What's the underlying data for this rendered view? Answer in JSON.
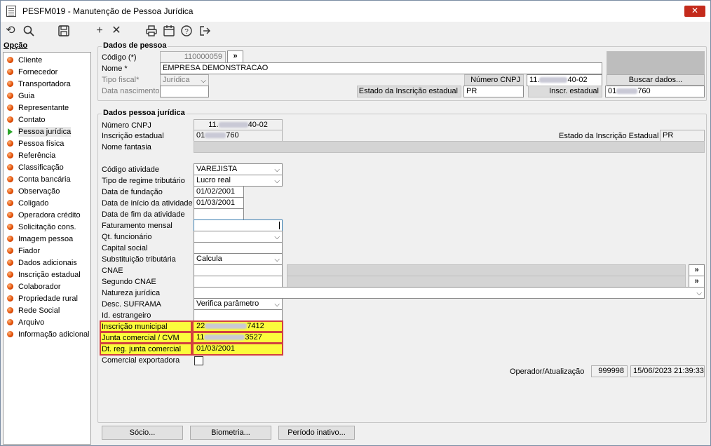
{
  "window": {
    "title": "PESFM019 - Manutenção de Pessoa Jurídica",
    "close_glyph": "✕"
  },
  "toolbar": {
    "icons": [
      "undo-icon",
      "search-icon",
      "save-icon",
      "add-icon",
      "delete-icon",
      "print-icon",
      "calendar-icon",
      "help-icon",
      "exit-icon"
    ]
  },
  "sidebar": {
    "header": "Opção",
    "items": [
      {
        "label": "Cliente"
      },
      {
        "label": "Fornecedor"
      },
      {
        "label": "Transportadora"
      },
      {
        "label": "Guia"
      },
      {
        "label": "Representante"
      },
      {
        "label": "Contato"
      },
      {
        "label": "Pessoa jurídica",
        "active": true
      },
      {
        "label": "Pessoa física"
      },
      {
        "label": "Referência"
      },
      {
        "label": "Classificação"
      },
      {
        "label": "Conta bancária"
      },
      {
        "label": "Observação"
      },
      {
        "label": "Coligado"
      },
      {
        "label": "Operadora crédito"
      },
      {
        "label": "Solicitação cons."
      },
      {
        "label": "Imagem pessoa"
      },
      {
        "label": "Fiador"
      },
      {
        "label": "Dados adicionais"
      },
      {
        "label": "Inscrição estadual"
      },
      {
        "label": "Colaborador"
      },
      {
        "label": "Propriedade rural"
      },
      {
        "label": "Rede Social"
      },
      {
        "label": "Arquivo"
      },
      {
        "label": "Informação adicional"
      }
    ]
  },
  "dados_pessoa": {
    "title": "Dados de pessoa",
    "codigo_label": "Código (*)",
    "codigo_value": "110000059",
    "codigo_btn": "»",
    "nome_label": "Nome *",
    "nome_value": "EMPRESA DEMONSTRACAO",
    "tipo_fiscal_label": "Tipo fiscal*",
    "tipo_fiscal_value": "Jurídica",
    "data_nasc_label": "Data nascimento",
    "numero_cnpj_label": "Número CNPJ",
    "numero_cnpj_prefix": "11.",
    "numero_cnpj_suffix": "40-02",
    "buscar_btn": "Buscar dados...",
    "estado_ie_label": "Estado da Inscrição estadual",
    "estado_ie_value": "PR",
    "inscr_estadual_label": "Inscr. estadual",
    "inscr_prefix": "01",
    "inscr_suffix": "760"
  },
  "dados_pj": {
    "title": "Dados pessoa jurídica",
    "numero_cnpj_label": "Número CNPJ",
    "cnpj_prefix": "11.",
    "cnpj_suffix": "40-02",
    "insc_est_label": "Inscrição estadual",
    "insc_prefix": "01",
    "insc_suffix": "760",
    "estado_ie_label": "Estado da Inscrição Estadual",
    "estado_ie_value": "PR",
    "nome_fantasia_label": "Nome fantasia",
    "codigo_atividade_label": "Código atividade",
    "codigo_atividade_value": "VAREJISTA",
    "regime_label": "Tipo de regime tributário",
    "regime_value": "Lucro real",
    "data_fundacao_label": "Data de fundação",
    "data_fundacao_value": "01/02/2001",
    "data_inicio_label": "Data de início da atividade",
    "data_inicio_value": "01/03/2001",
    "data_fim_label": "Data de fim da atividade",
    "faturamento_label": "Faturamento mensal",
    "qt_func_label": "Qt. funcionário",
    "capital_label": "Capital social",
    "subst_label": "Substituição tributária",
    "subst_value": "Calcula",
    "cnae_label": "CNAE",
    "cnae_btn": "»",
    "seg_cnae_label": "Segundo CNAE",
    "seg_cnae_btn": "»",
    "natureza_label": "Natureza jurídica",
    "suframa_label": "Desc. SUFRAMA",
    "suframa_value": "Verifica parâmetro",
    "id_estr_label": "Id. estrangeiro",
    "insc_mun_label": "Inscrição municipal",
    "insc_mun_prefix": "22",
    "insc_mun_suffix": "7412",
    "junta_label": "Junta comercial / CVM",
    "junta_prefix": "11",
    "junta_suffix": "3527",
    "dt_junta_label": "Dt. reg. junta comercial",
    "dt_junta_value": "01/03/2001",
    "com_exp_label": "Comercial exportadora",
    "operador_label": "Operador/Atualização",
    "operador_value": "999998",
    "atualizacao_value": "15/06/2023 21:39:33"
  },
  "footer": {
    "socio_btn": "Sócio...",
    "biometria_btn": "Biometria...",
    "periodo_btn": "Período inativo..."
  },
  "colors": {
    "highlight": "#ffff00",
    "highlight_border": "#d24040",
    "close_red": "#c42b1c"
  }
}
